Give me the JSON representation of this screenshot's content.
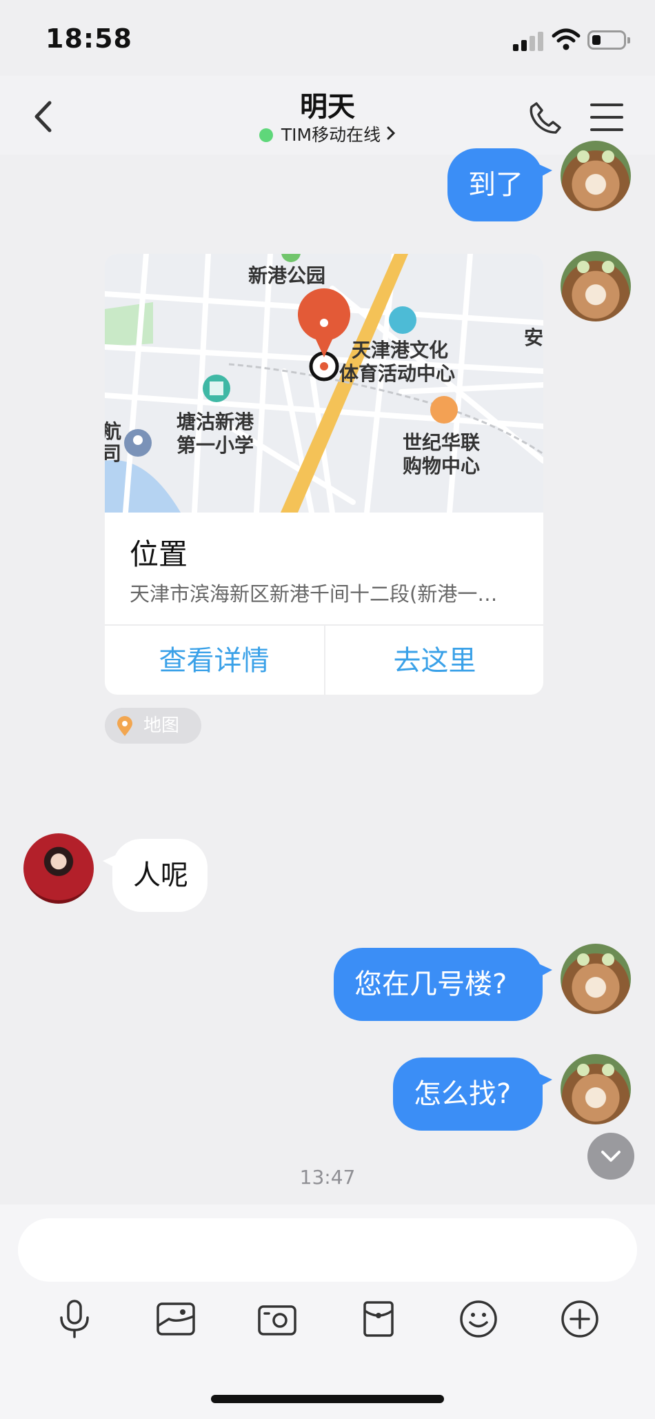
{
  "status_bar": {
    "time": "18:58"
  },
  "nav": {
    "title": "明天",
    "subtitle": "TIM移动在线",
    "online_color": "#5fd77a"
  },
  "messages": {
    "m1": {
      "text": "到了"
    },
    "location": {
      "title": "位置",
      "address": "天津市滨海新区新港千间十二段(新港一…",
      "btn_details": "查看详情",
      "btn_go": "去这里",
      "tag": "地图",
      "map_labels": {
        "park": "新港公园",
        "culture_1": "天津港文化",
        "culture_2": "体育活动中心",
        "school_1": "塘沽新港",
        "school_2": "第一小学",
        "mall_1": "世纪华联",
        "mall_2": "购物中心",
        "edge_right": "安",
        "edge_left_1": "航",
        "edge_left_2": "司"
      }
    },
    "m2": {
      "text": "人呢"
    },
    "m3": {
      "text": "您在几号楼?"
    },
    "m4": {
      "text": "怎么找?"
    },
    "timestamp": "13:47"
  },
  "input": {
    "placeholder": ""
  },
  "toolbar": [
    "mic-icon",
    "image-icon",
    "camera-icon",
    "red-packet-icon",
    "emoji-icon",
    "plus-icon"
  ],
  "colors": {
    "accent": "#3b8ef6",
    "link": "#3aa1e8"
  }
}
